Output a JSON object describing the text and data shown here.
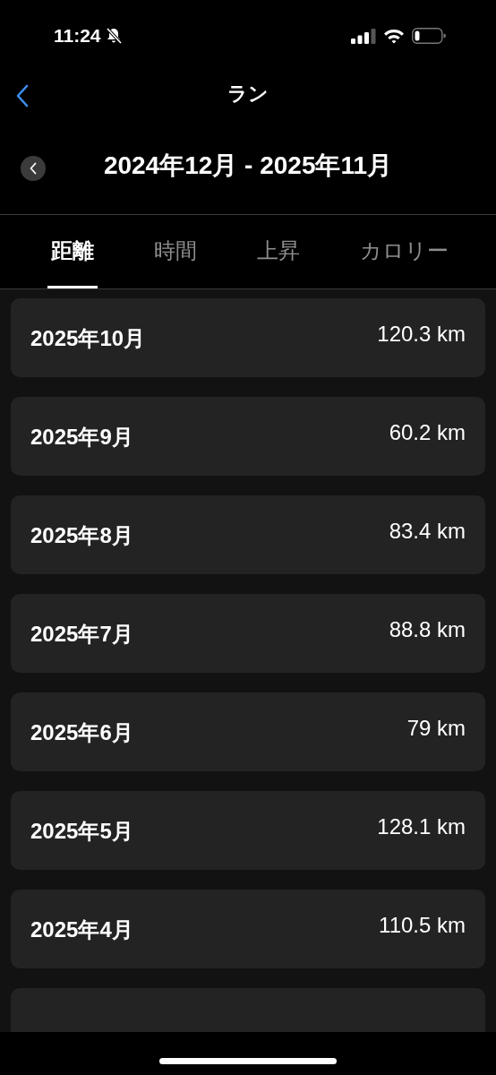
{
  "status_bar": {
    "time": "11:24"
  },
  "nav": {
    "title": "ラン"
  },
  "period": {
    "label": "2024年12月 - 2025年11月"
  },
  "tabs": [
    {
      "label": "距離",
      "selected": true
    },
    {
      "label": "時間",
      "selected": false
    },
    {
      "label": "上昇",
      "selected": false
    },
    {
      "label": "カロリー",
      "selected": false
    }
  ],
  "rows": [
    {
      "month": "2025年10月",
      "value": "120.3 km"
    },
    {
      "month": "2025年9月",
      "value": "60.2 km"
    },
    {
      "month": "2025年8月",
      "value": "83.4 km"
    },
    {
      "month": "2025年7月",
      "value": "88.8 km"
    },
    {
      "month": "2025年6月",
      "value": "79 km"
    },
    {
      "month": "2025年5月",
      "value": "128.1 km"
    },
    {
      "month": "2025年4月",
      "value": "110.5 km"
    }
  ]
}
